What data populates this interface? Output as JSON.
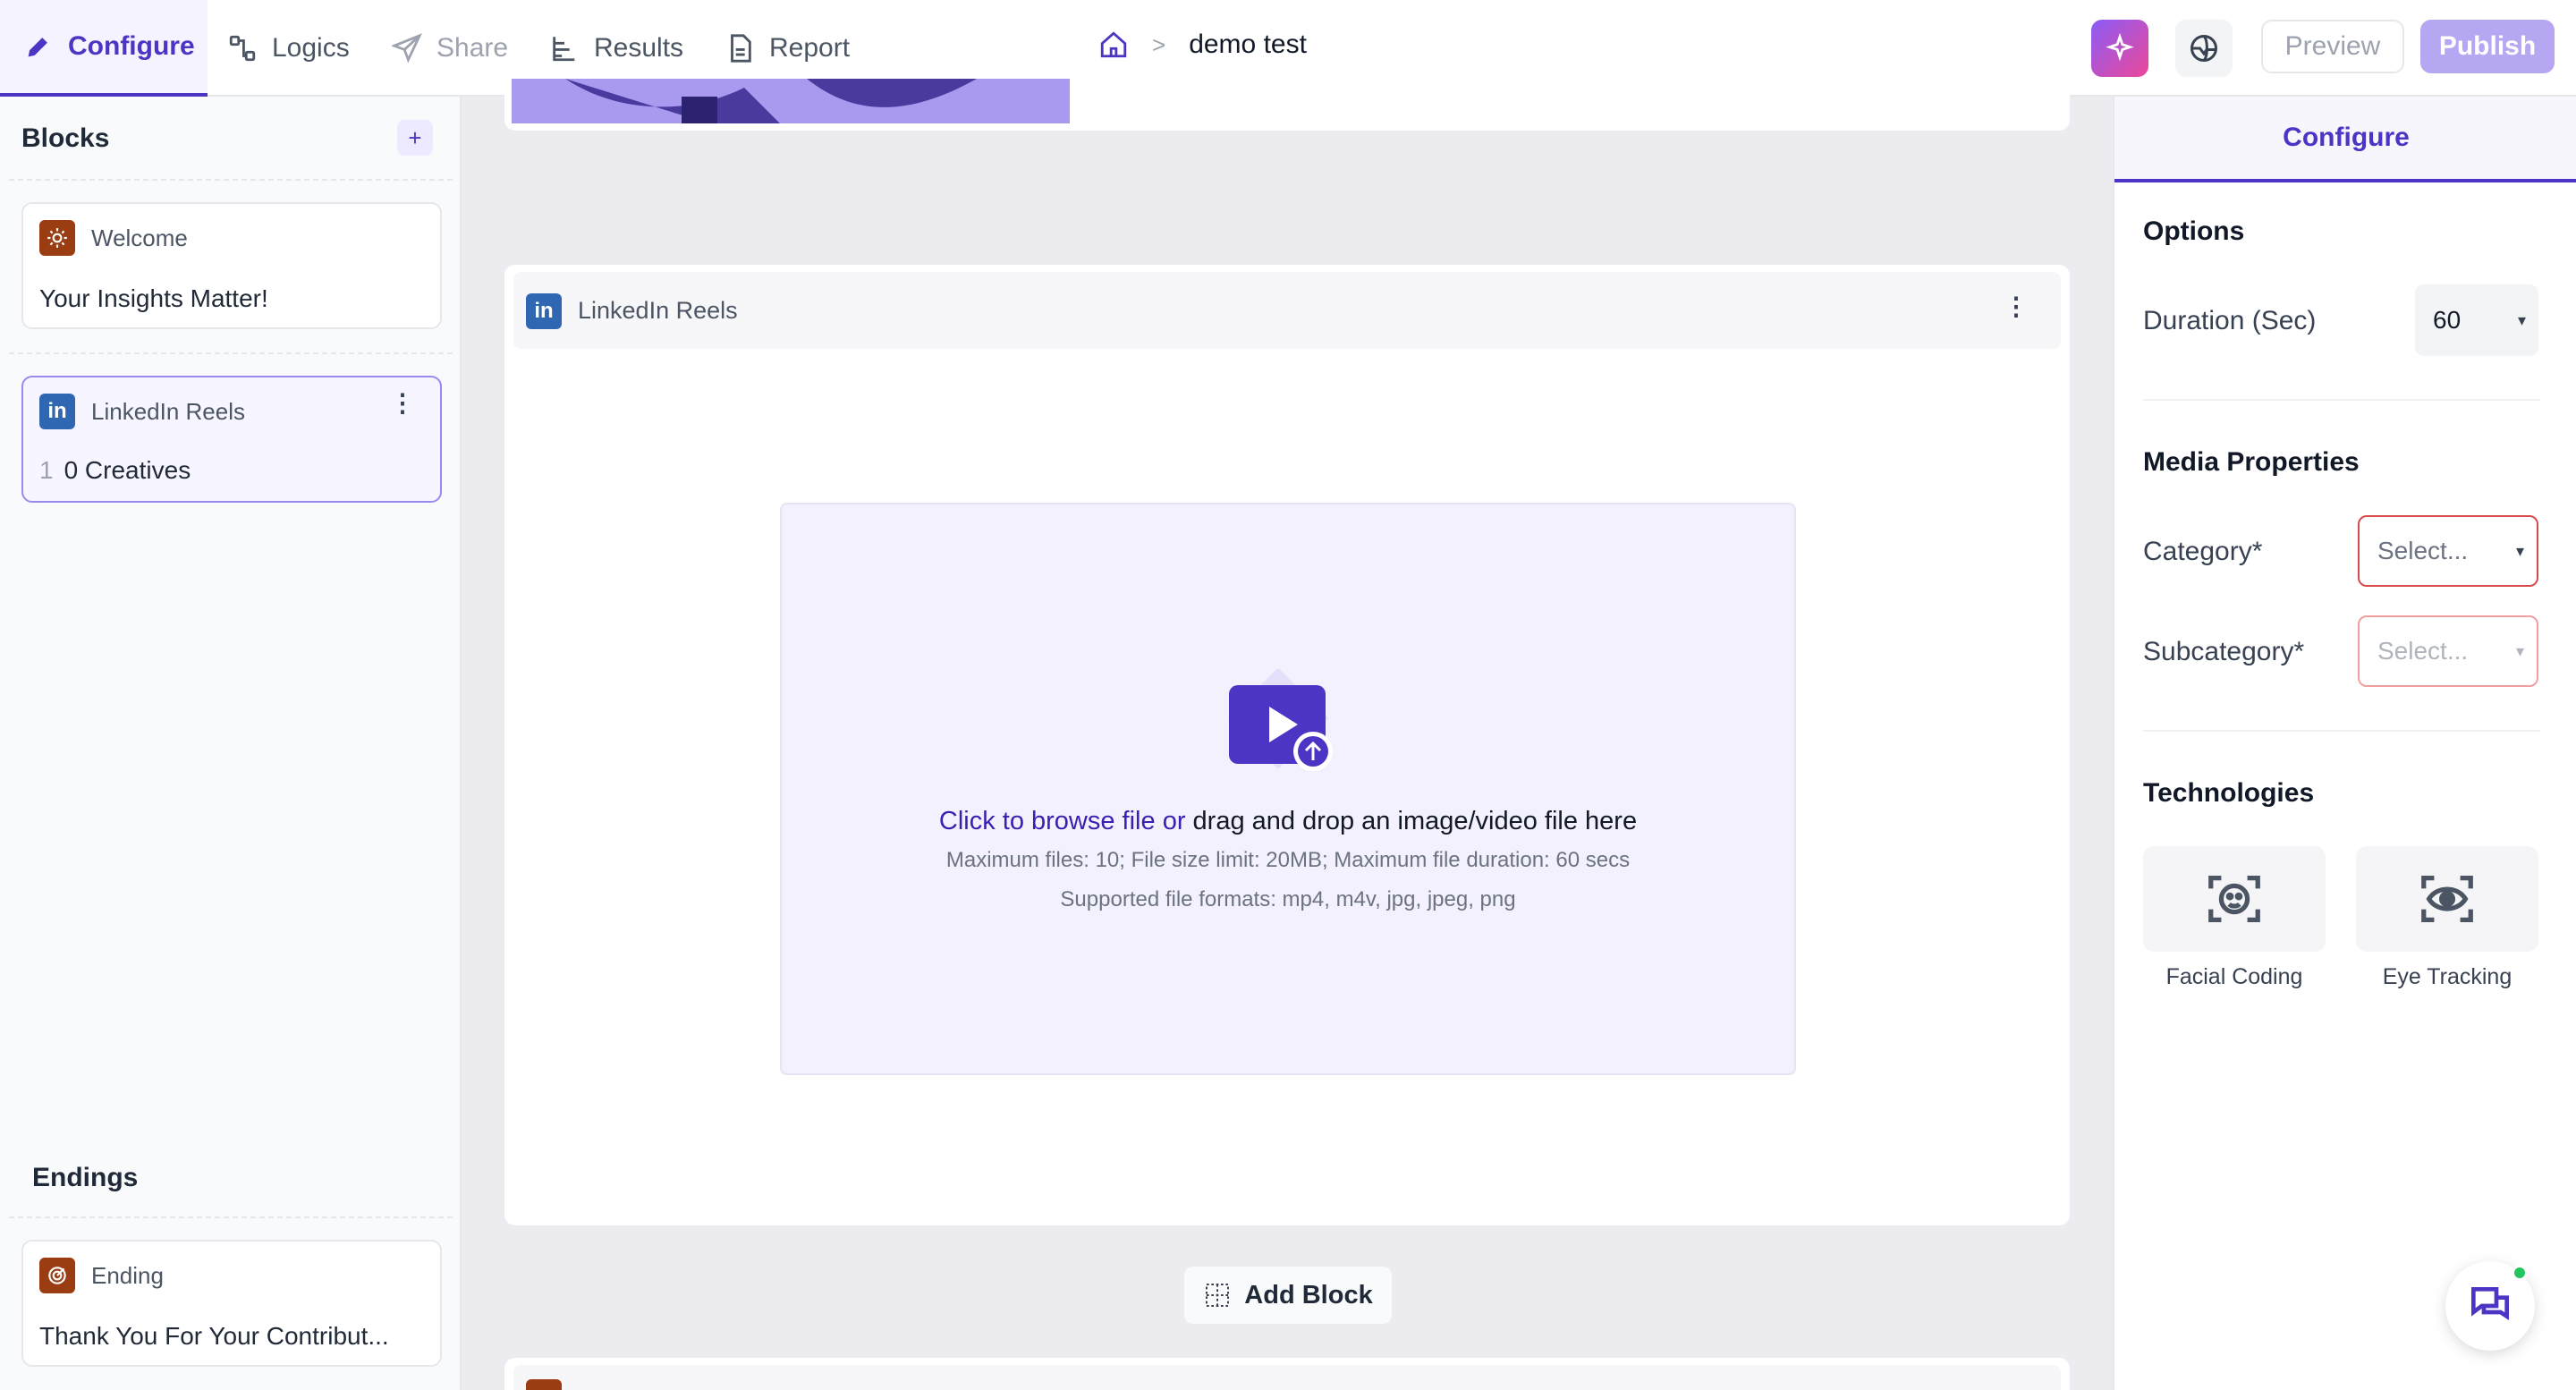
{
  "tabs": [
    {
      "label": "Configure",
      "icon": "pencil-icon"
    },
    {
      "label": "Logics",
      "icon": "logic-icon"
    },
    {
      "label": "Share",
      "icon": "send-icon"
    },
    {
      "label": "Results",
      "icon": "bar-chart-icon"
    },
    {
      "label": "Report",
      "icon": "document-icon"
    }
  ],
  "breadcrumb": {
    "separator": ">",
    "title": "demo test"
  },
  "header": {
    "preview_label": "Preview",
    "publish_label": "Publish"
  },
  "sidebar": {
    "blocks_title": "Blocks",
    "add_label": "+",
    "welcome": {
      "tag": "Welcome",
      "text": "Your Insights Matter!"
    },
    "linkedin": {
      "tag": "LinkedIn Reels",
      "index": "1",
      "text": "0 Creatives"
    },
    "endings_title": "Endings",
    "ending": {
      "tag": "Ending",
      "text": "Thank You For Your Contribut..."
    }
  },
  "main": {
    "block_title": "LinkedIn Reels",
    "upload": {
      "link_text": "Click to browse file or",
      "drop_text": " drag and drop an image/video file here",
      "limits": "Maximum files: 10; File size limit: 20MB; Maximum file duration: 60 secs",
      "formats": "Supported file formats: mp4, m4v, jpg, jpeg, png"
    },
    "add_block_label": "Add Block"
  },
  "right_panel": {
    "tab": "Configure",
    "options_title": "Options",
    "duration_label": "Duration (Sec)",
    "duration_value": "60",
    "media_title": "Media Properties",
    "category_label": "Category*",
    "category_placeholder": "Select...",
    "subcategory_label": "Subcategory*",
    "subcategory_placeholder": "Select...",
    "tech_title": "Technologies",
    "tech": [
      {
        "label": "Facial Coding",
        "icon": "face-scan-icon"
      },
      {
        "label": "Eye Tracking",
        "icon": "eye-scan-icon"
      }
    ]
  },
  "colors": {
    "accent": "#4c34c4",
    "publish": "#b7a6f2",
    "linkedin": "#2f67b3",
    "welcome": "#9a3d12",
    "error": "#e06666"
  }
}
